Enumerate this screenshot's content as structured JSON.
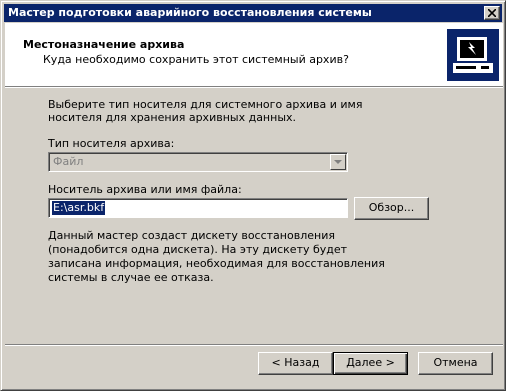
{
  "window": {
    "title": "Мастер подготовки аварийного восстановления системы"
  },
  "header": {
    "title": "Местоназначение архива",
    "subtitle": "Куда необходимо сохранить этот системный архив?"
  },
  "body": {
    "intro_line1": "Выберите тип носителя для системного архива и имя",
    "intro_line2": "носителя для хранения архивных данных.",
    "media_type_label": "Тип носителя архива:",
    "media_type_value": "Файл",
    "path_label": "Носитель архива или имя файла:",
    "path_value": "E:\\asr.bkf",
    "browse_label": "Обзор...",
    "note_line1": "Данный мастер создаст дискету восстановления",
    "note_line2": "(понадобится одна дискета). На эту дискету будет",
    "note_line3": "записана информация, необходимая для восстановления",
    "note_line4": "системы в случае ее отказа."
  },
  "footer": {
    "back_label": "< Назад",
    "next_label": "Далее >",
    "cancel_label": "Отмена"
  },
  "colors": {
    "titlebar": "#0a246a",
    "face": "#d4d0c8",
    "selection": "#0a246a"
  },
  "icons": [
    "close-icon",
    "dropdown-arrow-icon",
    "backup-computer-icon"
  ]
}
